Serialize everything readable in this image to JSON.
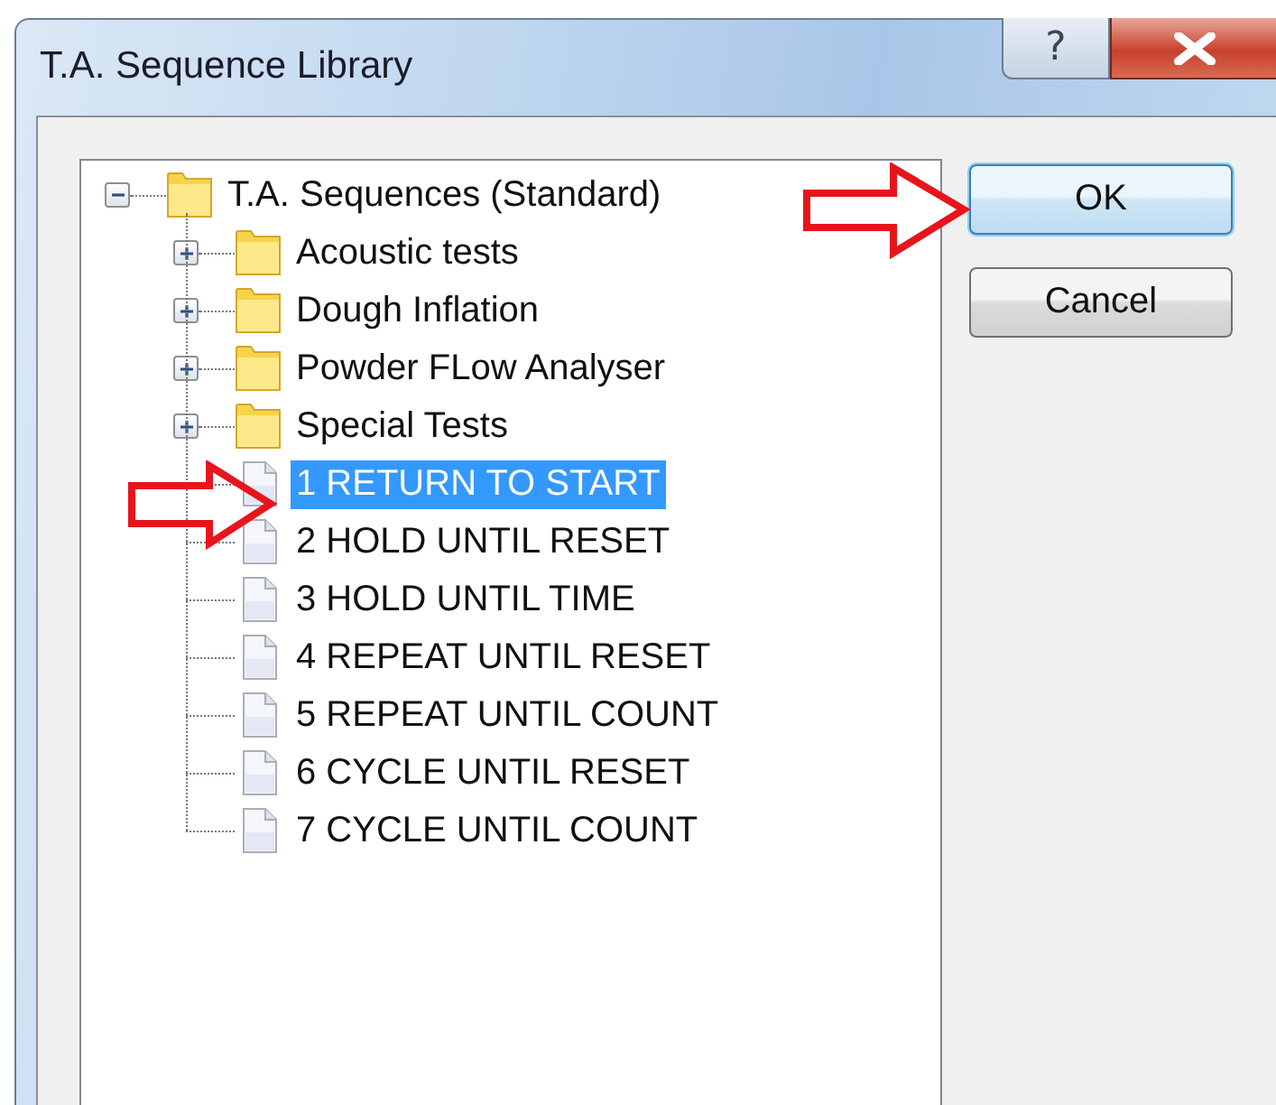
{
  "window": {
    "title": "T.A. Sequence Library",
    "help_button": "?"
  },
  "tree": [
    {
      "label": "T.A. Sequences (Standard)",
      "kind": "folder",
      "expanded": true,
      "selected": false,
      "children": [
        {
          "label": "Acoustic tests",
          "kind": "folder",
          "expanded": false,
          "selected": false
        },
        {
          "label": "Dough Inflation",
          "kind": "folder",
          "expanded": false,
          "selected": false
        },
        {
          "label": "Powder FLow Analyser",
          "kind": "folder",
          "expanded": false,
          "selected": false
        },
        {
          "label": "Special Tests",
          "kind": "folder",
          "expanded": false,
          "selected": false
        },
        {
          "label": "1 RETURN TO START",
          "kind": "file",
          "selected": true
        },
        {
          "label": "2 HOLD UNTIL RESET",
          "kind": "file",
          "selected": false
        },
        {
          "label": "3 HOLD UNTIL TIME",
          "kind": "file",
          "selected": false
        },
        {
          "label": "4 REPEAT UNTIL RESET",
          "kind": "file",
          "selected": false
        },
        {
          "label": "5 REPEAT UNTIL COUNT",
          "kind": "file",
          "selected": false
        },
        {
          "label": "6 CYCLE UNTIL RESET",
          "kind": "file",
          "selected": false
        },
        {
          "label": "7 CYCLE UNTIL COUNT",
          "kind": "file",
          "selected": false
        }
      ]
    }
  ],
  "buttons": [
    {
      "label": "OK",
      "default": true
    },
    {
      "label": "Cancel",
      "default": false
    }
  ]
}
